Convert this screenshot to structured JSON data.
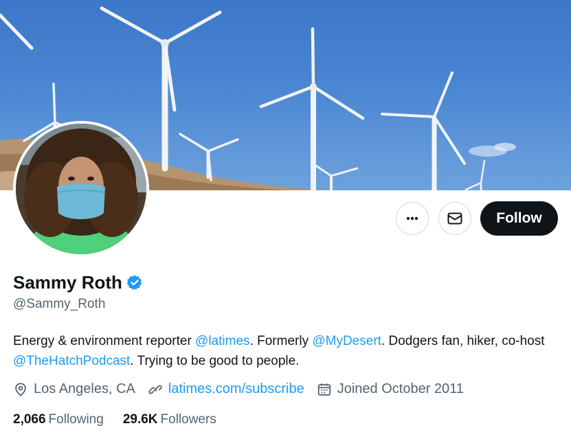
{
  "profile": {
    "display_name": "Sammy Roth",
    "handle": "@Sammy_Roth",
    "bio": {
      "part1": "Energy & environment reporter ",
      "mention1": "@latimes",
      "part2": ". Formerly ",
      "mention2": "@MyDesert",
      "part3": ". Dodgers fan, hiker, co-host ",
      "mention3": "@TheHatchPodcast",
      "part4": ". Trying to be good to people."
    },
    "location": "Los Angeles, CA",
    "website": "latimes.com/subscribe",
    "joined": "Joined October 2011",
    "following_count": "2,066",
    "following_label": "Following",
    "followers_count": "29.6K",
    "followers_label": "Followers"
  },
  "actions": {
    "more_label": "···",
    "follow_label": "Follow"
  },
  "icons": {
    "verified": "verified-badge-icon",
    "location": "location-pin-icon",
    "link": "link-icon",
    "calendar": "calendar-icon",
    "mail": "mail-icon",
    "more": "more-dots-icon"
  },
  "colors": {
    "accent": "#1d9bf0",
    "primary_text": "#0f1419",
    "secondary_text": "#536471",
    "follow_button": "#0f1419",
    "border": "#cfd9de"
  }
}
